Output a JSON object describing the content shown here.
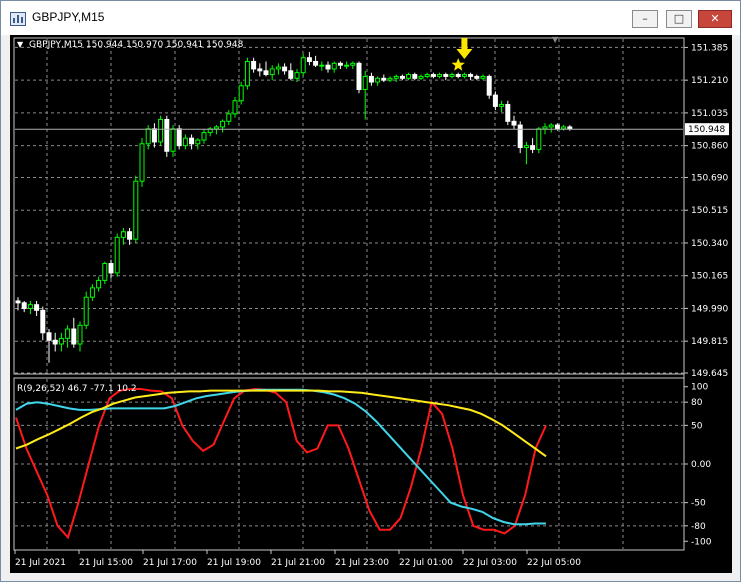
{
  "window": {
    "title": "GBPJPY,M15",
    "icons": {
      "app": "chart-window-icon",
      "minimize": "minimize-icon",
      "maximize": "maximize-icon",
      "close": "close-icon"
    },
    "buttons": {
      "minimize": "–",
      "maximize": "□",
      "close": "✕"
    }
  },
  "colors": {
    "background": "#000000",
    "bull_candle": "#00ff00",
    "bear_candle": "#ffffff",
    "red_line": "#ff1a1a",
    "cyan_line": "#3fd6ea",
    "yellow_line": "#ffeb1a",
    "arrow": "#ffe600",
    "star": "#ffe600",
    "grid": "#8a8a8a"
  },
  "chart_data": [
    {
      "type": "candlestick",
      "title": "GBPJPY,M15 150.944 150.970 150.941 150.948",
      "ylim": [
        149.645,
        151.43
      ],
      "y_ticks": [
        "151.385",
        "151.210",
        "151.035",
        "150.860",
        "150.690",
        "150.515",
        "150.340",
        "150.165",
        "149.990",
        "149.815",
        "149.645"
      ],
      "current_price": "150.948",
      "markers": {
        "arrow_index": 72,
        "star_index": 71
      },
      "candles": [
        [
          150.03,
          150.05,
          149.98,
          150.02
        ],
        [
          150.02,
          150.03,
          149.97,
          149.99
        ],
        [
          149.99,
          150.03,
          149.96,
          150.01
        ],
        [
          150.01,
          150.03,
          149.95,
          149.98
        ],
        [
          149.98,
          150.0,
          149.82,
          149.86
        ],
        [
          149.86,
          149.88,
          149.7,
          149.82
        ],
        [
          149.82,
          149.86,
          149.76,
          149.8
        ],
        [
          149.8,
          149.86,
          149.76,
          149.83
        ],
        [
          149.83,
          149.9,
          149.78,
          149.88
        ],
        [
          149.88,
          149.94,
          149.78,
          149.8
        ],
        [
          149.8,
          149.92,
          149.76,
          149.9
        ],
        [
          149.9,
          150.08,
          149.88,
          150.05
        ],
        [
          150.05,
          150.12,
          150.03,
          150.1
        ],
        [
          150.1,
          150.16,
          150.08,
          150.14
        ],
        [
          150.14,
          150.24,
          150.12,
          150.23
        ],
        [
          150.23,
          150.25,
          150.15,
          150.18
        ],
        [
          150.18,
          150.39,
          150.16,
          150.37
        ],
        [
          150.37,
          150.42,
          150.33,
          150.4
        ],
        [
          150.4,
          150.42,
          150.33,
          150.36
        ],
        [
          150.36,
          150.7,
          150.34,
          150.67
        ],
        [
          150.67,
          150.9,
          150.64,
          150.87
        ],
        [
          150.87,
          150.97,
          150.84,
          150.95
        ],
        [
          150.95,
          150.98,
          150.85,
          150.88
        ],
        [
          150.88,
          151.02,
          150.86,
          151.0
        ],
        [
          151.0,
          151.02,
          150.8,
          150.83
        ],
        [
          150.83,
          150.97,
          150.8,
          150.95
        ],
        [
          150.95,
          150.97,
          150.84,
          150.86
        ],
        [
          150.86,
          150.92,
          150.84,
          150.9
        ],
        [
          150.9,
          150.92,
          150.84,
          150.87
        ],
        [
          150.87,
          150.9,
          150.84,
          150.89
        ],
        [
          150.89,
          150.95,
          150.87,
          150.93
        ],
        [
          150.93,
          150.96,
          150.91,
          150.95
        ],
        [
          150.95,
          150.97,
          150.92,
          150.96
        ],
        [
          150.96,
          151.0,
          150.93,
          150.99
        ],
        [
          150.99,
          151.05,
          150.97,
          151.03
        ],
        [
          151.03,
          151.12,
          151.01,
          151.1
        ],
        [
          151.1,
          151.2,
          151.08,
          151.18
        ],
        [
          151.18,
          151.33,
          151.16,
          151.31
        ],
        [
          151.31,
          151.33,
          151.25,
          151.27
        ],
        [
          151.27,
          151.3,
          151.23,
          151.26
        ],
        [
          151.26,
          151.31,
          151.23,
          151.24
        ],
        [
          151.24,
          151.29,
          151.21,
          151.27
        ],
        [
          151.27,
          151.3,
          151.24,
          151.28
        ],
        [
          151.28,
          151.3,
          151.24,
          151.26
        ],
        [
          151.26,
          151.3,
          151.21,
          151.22
        ],
        [
          151.22,
          151.27,
          151.2,
          151.25
        ],
        [
          151.25,
          151.35,
          151.23,
          151.33
        ],
        [
          151.33,
          151.36,
          151.29,
          151.31
        ],
        [
          151.31,
          151.34,
          151.28,
          151.29
        ],
        [
          151.29,
          151.31,
          151.26,
          151.29
        ],
        [
          151.29,
          151.31,
          151.25,
          151.27
        ],
        [
          151.27,
          151.31,
          151.25,
          151.3
        ],
        [
          151.3,
          151.31,
          151.27,
          151.29
        ],
        [
          151.29,
          151.31,
          151.27,
          151.29
        ],
        [
          151.29,
          151.31,
          151.27,
          151.3
        ],
        [
          151.3,
          151.31,
          151.14,
          151.16
        ],
        [
          151.16,
          151.26,
          151.0,
          151.23
        ],
        [
          151.23,
          151.25,
          151.18,
          151.2
        ],
        [
          151.2,
          151.23,
          151.18,
          151.22
        ],
        [
          151.22,
          151.24,
          151.2,
          151.21
        ],
        [
          151.21,
          151.23,
          151.2,
          151.22
        ],
        [
          151.22,
          151.24,
          151.2,
          151.23
        ],
        [
          151.23,
          151.24,
          151.21,
          151.22
        ],
        [
          151.22,
          151.25,
          151.21,
          151.24
        ],
        [
          151.24,
          151.25,
          151.21,
          151.22
        ],
        [
          151.22,
          151.24,
          151.21,
          151.23
        ],
        [
          151.23,
          151.25,
          151.22,
          151.24
        ],
        [
          151.24,
          151.25,
          151.22,
          151.23
        ],
        [
          151.23,
          151.25,
          151.22,
          151.24
        ],
        [
          151.24,
          151.25,
          151.21,
          151.23
        ],
        [
          151.23,
          151.25,
          151.22,
          151.24
        ],
        [
          151.24,
          151.25,
          151.22,
          151.23
        ],
        [
          151.23,
          151.25,
          151.22,
          151.24
        ],
        [
          151.24,
          151.25,
          151.21,
          151.23
        ],
        [
          151.23,
          151.24,
          151.21,
          151.22
        ],
        [
          151.22,
          151.24,
          151.21,
          151.23
        ],
        [
          151.23,
          151.24,
          151.11,
          151.13
        ],
        [
          151.13,
          151.15,
          151.05,
          151.07
        ],
        [
          151.07,
          151.1,
          151.04,
          151.08
        ],
        [
          151.08,
          151.1,
          150.97,
          150.99
        ],
        [
          150.99,
          151.02,
          150.95,
          150.97
        ],
        [
          150.97,
          150.99,
          150.82,
          150.85
        ],
        [
          150.85,
          150.88,
          150.76,
          150.86
        ],
        [
          150.86,
          150.9,
          150.82,
          150.84
        ],
        [
          150.84,
          150.96,
          150.82,
          150.95
        ],
        [
          150.95,
          150.98,
          150.92,
          150.96
        ],
        [
          150.96,
          150.98,
          150.93,
          150.97
        ],
        [
          150.97,
          150.98,
          150.94,
          150.95
        ],
        [
          150.95,
          150.97,
          150.94,
          150.96
        ],
        [
          150.96,
          150.97,
          150.94,
          150.95
        ]
      ]
    },
    {
      "type": "line",
      "title": "R(9,26,52) 46.7 -77.1 10.2",
      "ylim": [
        -110,
        110
      ],
      "y_ticks": [
        "100",
        "80",
        "50",
        "0.00",
        "-50",
        "-80",
        "-100"
      ],
      "x_labels": [
        "21 Jul 2021",
        "21 Jul 15:00",
        "21 Jul 17:00",
        "21 Jul 19:00",
        "21 Jul 21:00",
        "21 Jul 23:00",
        "22 Jul 01:00",
        "22 Jul 03:00",
        "22 Jul 05:00"
      ],
      "series": [
        {
          "color": "#ff1a1a",
          "values": [
            60,
            20,
            -10,
            -40,
            -80,
            -95,
            -50,
            0,
            50,
            85,
            95,
            97,
            97,
            95,
            94,
            85,
            50,
            30,
            17,
            25,
            55,
            85,
            95,
            97,
            96,
            92,
            80,
            30,
            15,
            20,
            50,
            50,
            20,
            -20,
            -60,
            -85,
            -85,
            -70,
            -30,
            20,
            80,
            65,
            20,
            -40,
            -80,
            -85,
            -85,
            -90,
            -80,
            -40,
            20,
            50
          ]
        },
        {
          "color": "#3fd6ea",
          "values": [
            70,
            78,
            80,
            78,
            75,
            72,
            70,
            70,
            71,
            72,
            72,
            72,
            72,
            72,
            72,
            75,
            80,
            85,
            88,
            90,
            92,
            94,
            95,
            96,
            96,
            96,
            96,
            96,
            95,
            93,
            90,
            85,
            78,
            68,
            55,
            40,
            25,
            10,
            -5,
            -20,
            -35,
            -50,
            -55,
            -58,
            -62,
            -70,
            -75,
            -78,
            -78,
            -77,
            -77
          ]
        },
        {
          "color": "#ffeb1a",
          "values": [
            20,
            25,
            32,
            38,
            45,
            52,
            60,
            67,
            72,
            78,
            82,
            86,
            88,
            90,
            92,
            93,
            94,
            94,
            95,
            95,
            95,
            95,
            95,
            95,
            95,
            95,
            95,
            95,
            95,
            94,
            94,
            93,
            92,
            90,
            88,
            86,
            84,
            82,
            80,
            78,
            76,
            73,
            70,
            65,
            58,
            50,
            40,
            30,
            20,
            10
          ]
        }
      ]
    }
  ]
}
